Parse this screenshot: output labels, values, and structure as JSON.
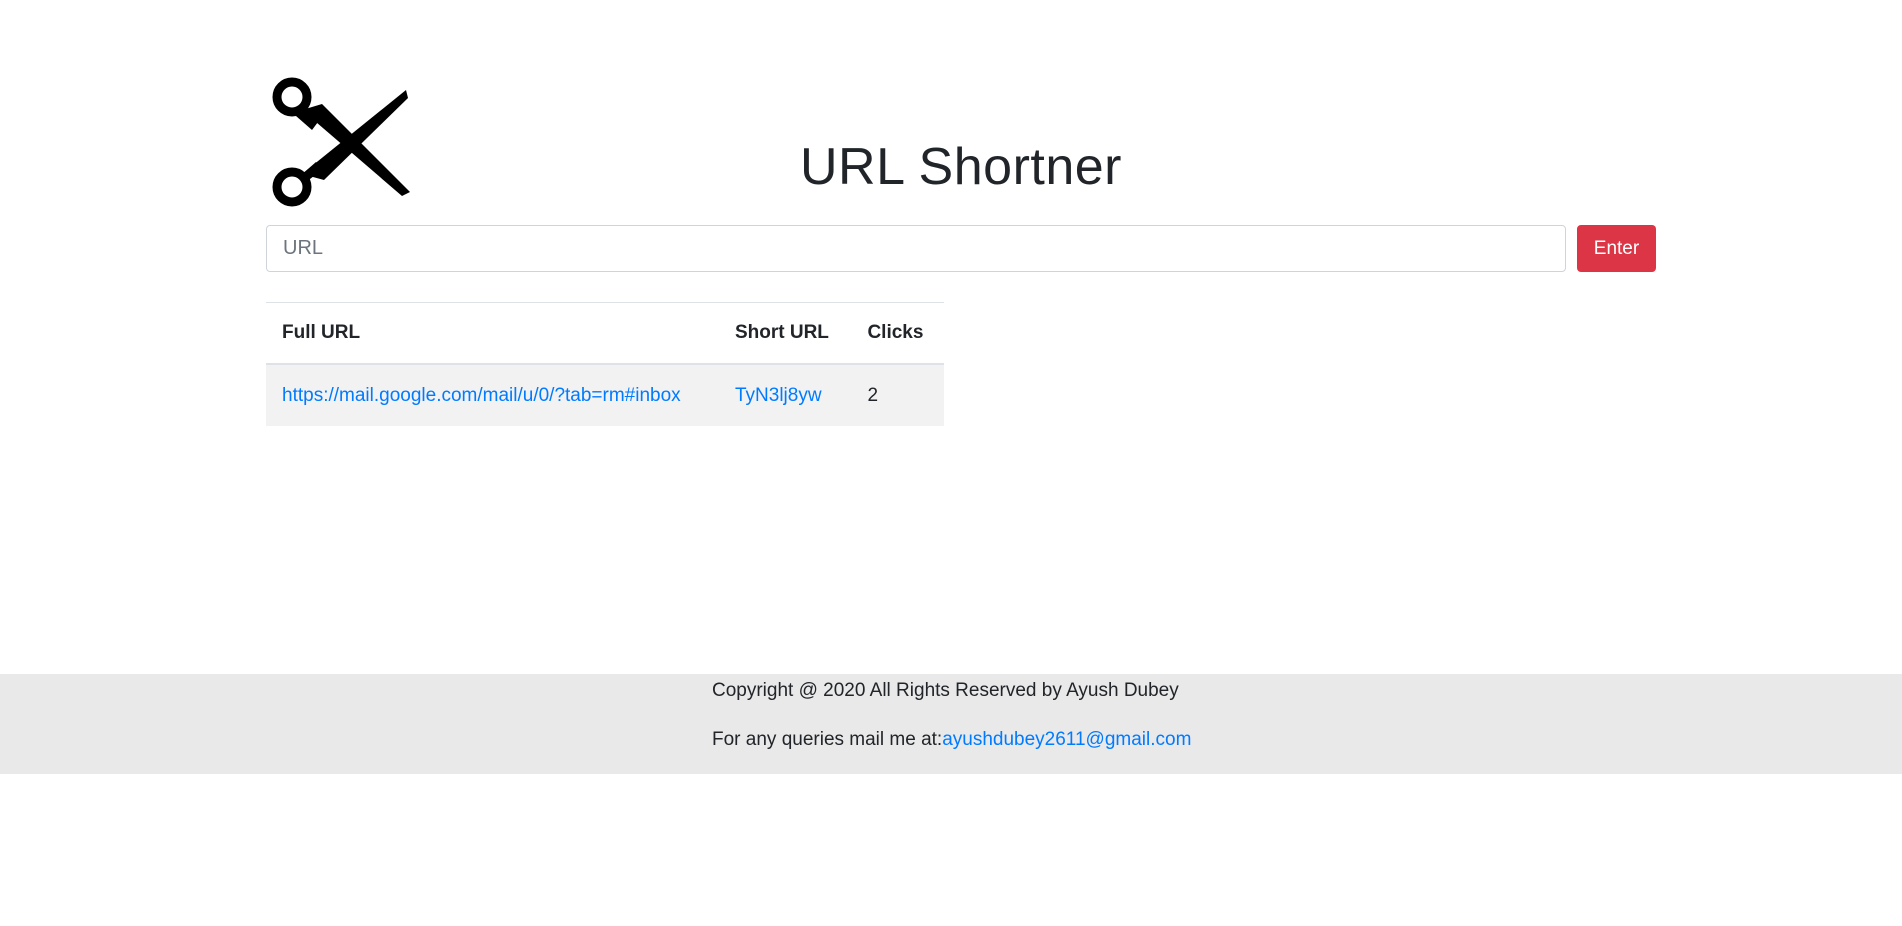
{
  "header": {
    "logo_icon": "scissors-icon",
    "title": "URL Shortner"
  },
  "form": {
    "placeholder": "URL",
    "value": "",
    "submit_label": "Enter",
    "submit_color": "#dc3545"
  },
  "table": {
    "headers": [
      "Full URL",
      "Short URL",
      "Clicks"
    ],
    "rows": [
      {
        "full_url": "https://mail.google.com/mail/u/0/?tab=rm#inbox",
        "short_url": "TyN3lj8yw",
        "clicks": "2"
      }
    ]
  },
  "footer": {
    "copyright": "Copyright @ 2020 All Rights Reserved by Ayush Dubey",
    "mail_prefix": "For any queries mail me at:",
    "mail_address": "ayushdubey2611@gmail.com"
  },
  "colors": {
    "link": "#007bff",
    "footer_bg": "#e9e9e9",
    "row_bg": "#f2f2f2"
  }
}
